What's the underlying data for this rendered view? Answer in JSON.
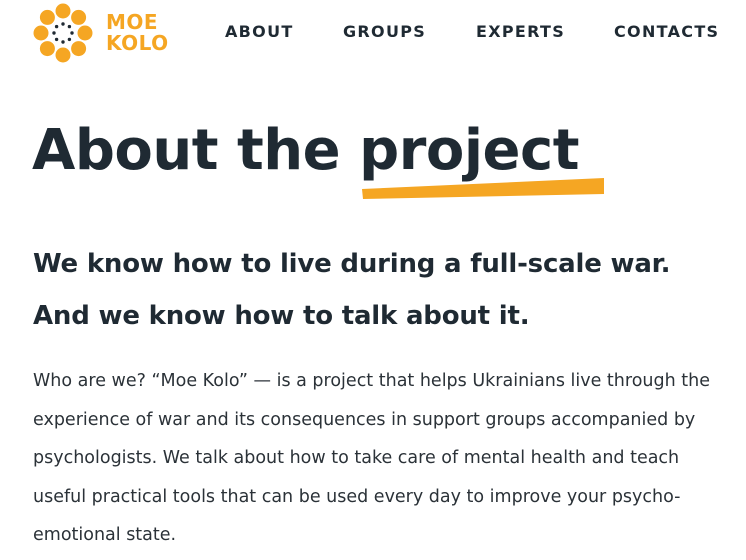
{
  "brand": {
    "line1": "MOE",
    "line2": "KOLO",
    "accent_color": "#f5a623",
    "logo_icon": "sun-circle-logo-icon"
  },
  "nav": {
    "items": [
      "ABOUT",
      "GROUPS",
      "EXPERTS",
      "CONTACTS"
    ]
  },
  "hero": {
    "title_prefix": "About the ",
    "title_highlight": "project",
    "subheading": "We know how to live during a full-scale war. And we know how to talk about it.",
    "paragraph": "Who are we? “Moe Kolo” — is a project that helps Ukrainians live through the experience of war and its consequences in support groups accompanied by psychologists. We talk about how to take care of mental health and teach useful practical tools that can be used every day to improve your psycho-emotional state."
  },
  "colors": {
    "text": "#1f2a33",
    "accent": "#f5a623",
    "background": "#ffffff"
  }
}
